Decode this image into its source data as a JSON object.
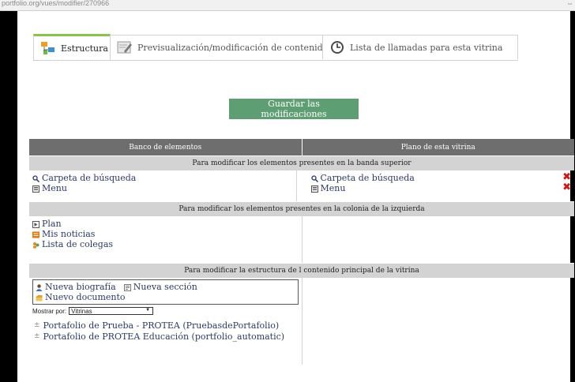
{
  "browser": {
    "url": "portfolio.org/vues/modifier/270966",
    "ext": "⇔"
  },
  "tabs": [
    {
      "label": "Estructura",
      "active": true
    },
    {
      "label": "Previsualización/modificación de contenido",
      "active": false
    },
    {
      "label": "Lista de llamadas para esta vitrina",
      "active": false
    }
  ],
  "save_label": "Guardar las modificaciones",
  "table": {
    "col_left": "Banco de elementos",
    "col_right": "Plano de esta vitrina",
    "section_top": "Para modificar los elementos presentes en la banda superior",
    "top_left": [
      "Carpeta de búsqueda",
      "Menu"
    ],
    "top_right": [
      "Carpeta de búsqueda",
      "Menu"
    ],
    "section_left": "Para modificar los elementos presentes en la colonia de la izquierda",
    "left_items": [
      "Plan",
      "Mis noticias",
      "Lista de colegas"
    ],
    "section_main": "Para modificar la estructura de l contenido principal de la vitrina",
    "new_bio": "Nueva biografía",
    "new_section": "Nueva sección",
    "new_doc": "Nuevo documento",
    "show_label": "Mostrar por:",
    "show_value": "Vitrinas",
    "portfolios": [
      "Portafolio de Prueba - PROTEA (PruebasdePortafolio)",
      "Portafolio de PROTEA Educación (portfolio_automatic)"
    ]
  },
  "colors": {
    "tab_accent": "#8bc34a",
    "save_bg": "#5e9e73",
    "delete": "#dd1111"
  }
}
